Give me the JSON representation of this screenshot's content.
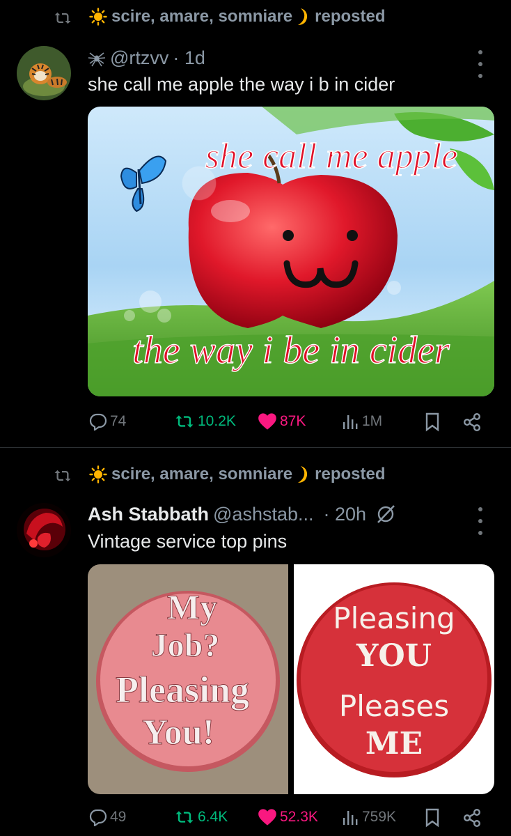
{
  "tweets": [
    {
      "repost_by": "scire, amare, somniare",
      "repost_suffix": "reposted",
      "handle": "@rtzvv",
      "time": "· 1d",
      "text": "she call me apple the way i b in cider",
      "image_caption_top": "she call me apple",
      "image_face": "·  ·\nω",
      "image_caption_bottom": "the way i be in cider",
      "stats": {
        "replies": "74",
        "reposts": "10.2K",
        "likes": "87K",
        "views": "1M"
      },
      "icons": [
        "retweet-icon",
        "sun-icon",
        "moon-icon",
        "spider-icon",
        "more-icon",
        "reply-icon",
        "heart-icon",
        "views-icon",
        "bookmark-icon",
        "share-icon"
      ]
    },
    {
      "repost_by": "scire, amare, somniare",
      "repost_suffix": "reposted",
      "display_name": "Ash Stabbath",
      "handle": "@ashstab...",
      "time": "· 20h",
      "text": "Vintage service top pins",
      "pin_left": [
        "My",
        "Job?",
        "Pleasing",
        "You!"
      ],
      "pin_right": [
        "Pleasing",
        "YOU",
        "Pleases",
        "ME"
      ],
      "stats": {
        "replies": "49",
        "reposts": "6.4K",
        "likes": "52.3K",
        "views": "759K"
      }
    }
  ],
  "colors": {
    "repost_green": "#00ba7c",
    "like_pink": "#f91880",
    "muted": "#71767b",
    "text": "#e7e9ea"
  }
}
